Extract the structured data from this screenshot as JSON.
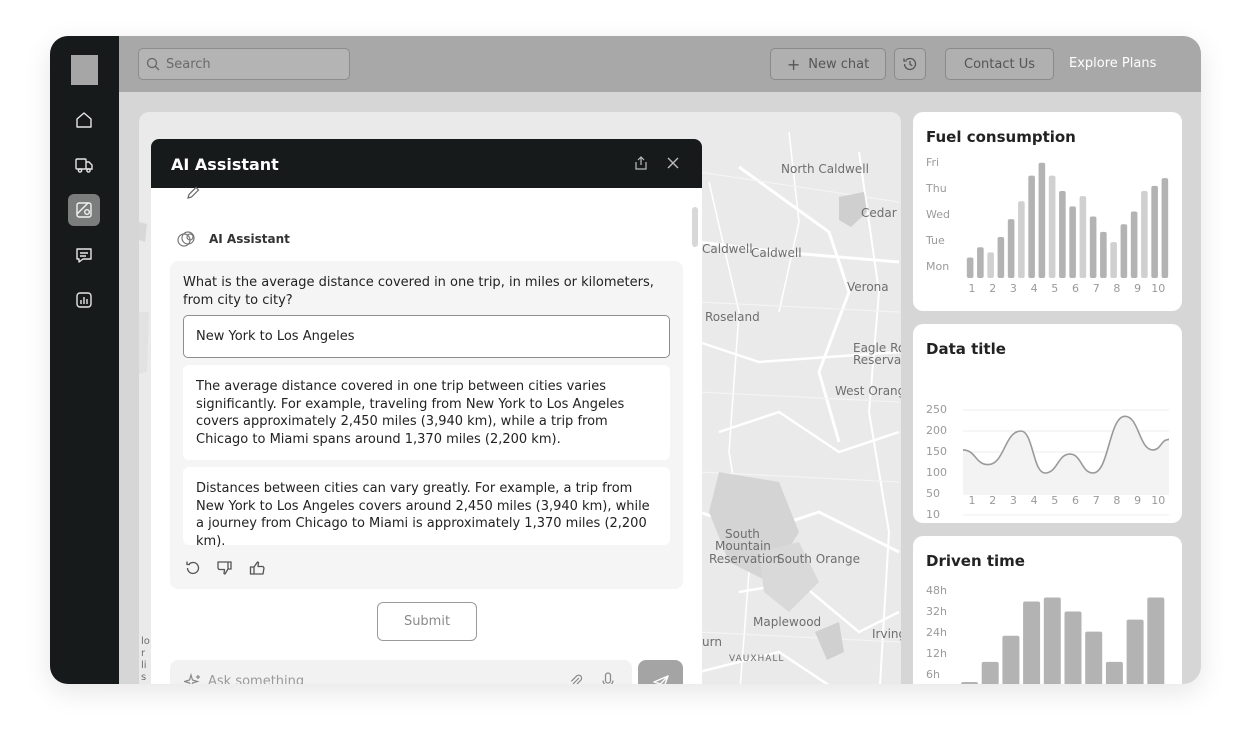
{
  "topbar": {
    "search_placeholder": "Search",
    "new_chat": "New chat",
    "contact": "Contact Us",
    "explore": "Explore Plans"
  },
  "sidebar": {
    "items": [
      {
        "icon": "home-icon",
        "active": false
      },
      {
        "icon": "truck-icon",
        "active": false
      },
      {
        "icon": "map-icon",
        "active": true
      },
      {
        "icon": "chat-icon",
        "active": false
      },
      {
        "icon": "analytics-icon",
        "active": false
      }
    ]
  },
  "map": {
    "labels": [
      "North Caldwell",
      "Cedar",
      "Caldwell",
      "Caldwell",
      "Verona",
      "Roseland",
      "Eagle Ro",
      "Reservat",
      "West Orang",
      "South",
      "Mountain",
      "Reservation",
      "South Orange",
      "Maplewood",
      "Irving",
      "urn",
      "VAUXHALL",
      "lo",
      "r",
      "li",
      "s"
    ]
  },
  "assistant": {
    "title": "AI Assistant",
    "sender": "AI Assistant",
    "question": "What is the average distance covered in one trip, in miles or kilometers, from city to city?",
    "answer_value": "New York to Los Angeles",
    "responses": [
      "The average distance covered in one trip between cities varies significantly. For example, traveling from New York to Los Angeles covers approximately 2,450 miles (3,940 km), while a trip from Chicago to Miami spans around 1,370 miles (2,200 km).",
      "Distances between cities can vary greatly. For example, a trip from New York to Los Angeles covers around 2,450 miles (3,940 km), while a journey from Chicago to Miami is approximately 1,370 miles (2,200 km)."
    ],
    "submit": "Submit",
    "ask_placeholder": "Ask something"
  },
  "chart_data": [
    {
      "type": "bar",
      "title": "Fuel consumption",
      "categories": [
        "1",
        "2",
        "3",
        "4",
        "5",
        "6",
        "7",
        "8",
        "9",
        "10"
      ],
      "ytick_labels": [
        "Mon",
        "Tue",
        "Wed",
        "Thu",
        "Fri"
      ],
      "ylim": [
        0,
        5
      ],
      "values": [
        0.8,
        1.2,
        1.0,
        1.6,
        2.3,
        3.0,
        4.0,
        4.5,
        4.0,
        3.4,
        2.8,
        3.2,
        2.4,
        1.8,
        1.4,
        2.1,
        2.6,
        3.4,
        3.6,
        3.9
      ]
    },
    {
      "type": "line",
      "title": "Data title",
      "x": [
        1,
        2,
        3,
        4,
        5,
        6,
        7,
        8,
        9,
        10
      ],
      "ytick_labels": [
        "10",
        "50",
        "100",
        "150",
        "200",
        "250"
      ],
      "ylim": [
        10,
        250
      ],
      "values": [
        155,
        120,
        200,
        100,
        145,
        100,
        235,
        155,
        180
      ],
      "grid": true
    },
    {
      "type": "bar",
      "title": "Driven time",
      "ytick_labels": [
        "6h",
        "12h",
        "24h",
        "32h",
        "48h"
      ],
      "values": [
        2,
        12,
        25,
        42,
        44,
        37,
        27,
        12,
        33,
        44
      ]
    }
  ]
}
